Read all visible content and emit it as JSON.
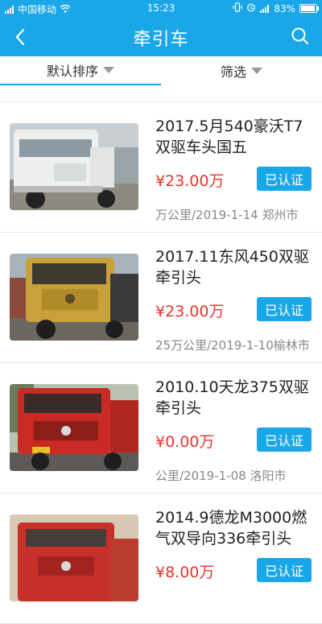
{
  "status_bar": {
    "carrier": "中国移动",
    "time": "15:23",
    "battery": "83%",
    "battery_level": 0.83
  },
  "app_bar": {
    "title": "牵引车"
  },
  "filter_bar": {
    "sort_label": "默认排序",
    "filter_label": "筛选"
  },
  "colors": {
    "primary": "#1aa7e8",
    "price": "#e8342b"
  },
  "listings": [
    {
      "title": "2017.5月540豪沃T7双驱车头国五",
      "price": "¥23.00万",
      "badge": "已认证",
      "meta": "万公里/2019-1-14 郑州市"
    },
    {
      "title": "2017.11东风450双驱牵引头",
      "price": "¥23.00万",
      "badge": "已认证",
      "meta": "25万公里/2019-1-10榆林市"
    },
    {
      "title": "2010.10天龙375双驱牵引头",
      "price": "¥0.00万",
      "badge": "已认证",
      "meta": "公里/2019-1-08    洛阳市"
    },
    {
      "title": "2014.9德龙M3000燃气双导向336牵引头",
      "price": "¥8.00万",
      "badge": "已认证",
      "meta": ""
    }
  ]
}
